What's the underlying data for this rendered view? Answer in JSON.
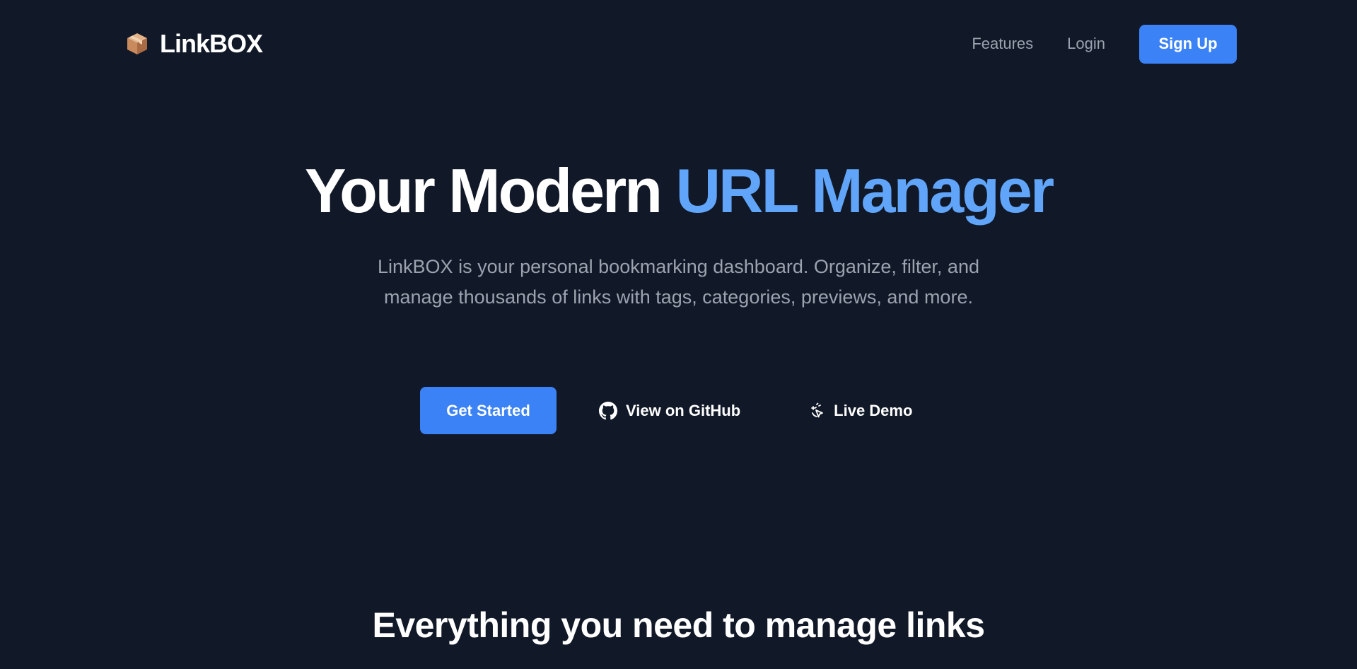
{
  "brand": {
    "icon": "package-box-icon",
    "name": "LinkBOX"
  },
  "nav": {
    "features": "Features",
    "login": "Login",
    "signup": "Sign Up"
  },
  "hero": {
    "title_main": "Your Modern ",
    "title_accent": "URL Manager",
    "subtitle": "LinkBOX is your personal bookmarking dashboard. Organize, filter, and manage thousands of links with tags, categories, previews, and more."
  },
  "cta": {
    "get_started": "Get Started",
    "github": {
      "icon": "github-icon",
      "label": "View on GitHub"
    },
    "demo": {
      "icon": "sparkle-pointer-icon",
      "label": "Live Demo"
    }
  },
  "features_section": {
    "title": "Everything you need to manage links"
  },
  "colors": {
    "background": "#111827",
    "primary": "#3b82f6",
    "accent_text": "#60a5fa",
    "muted_text": "#9ca3af"
  }
}
